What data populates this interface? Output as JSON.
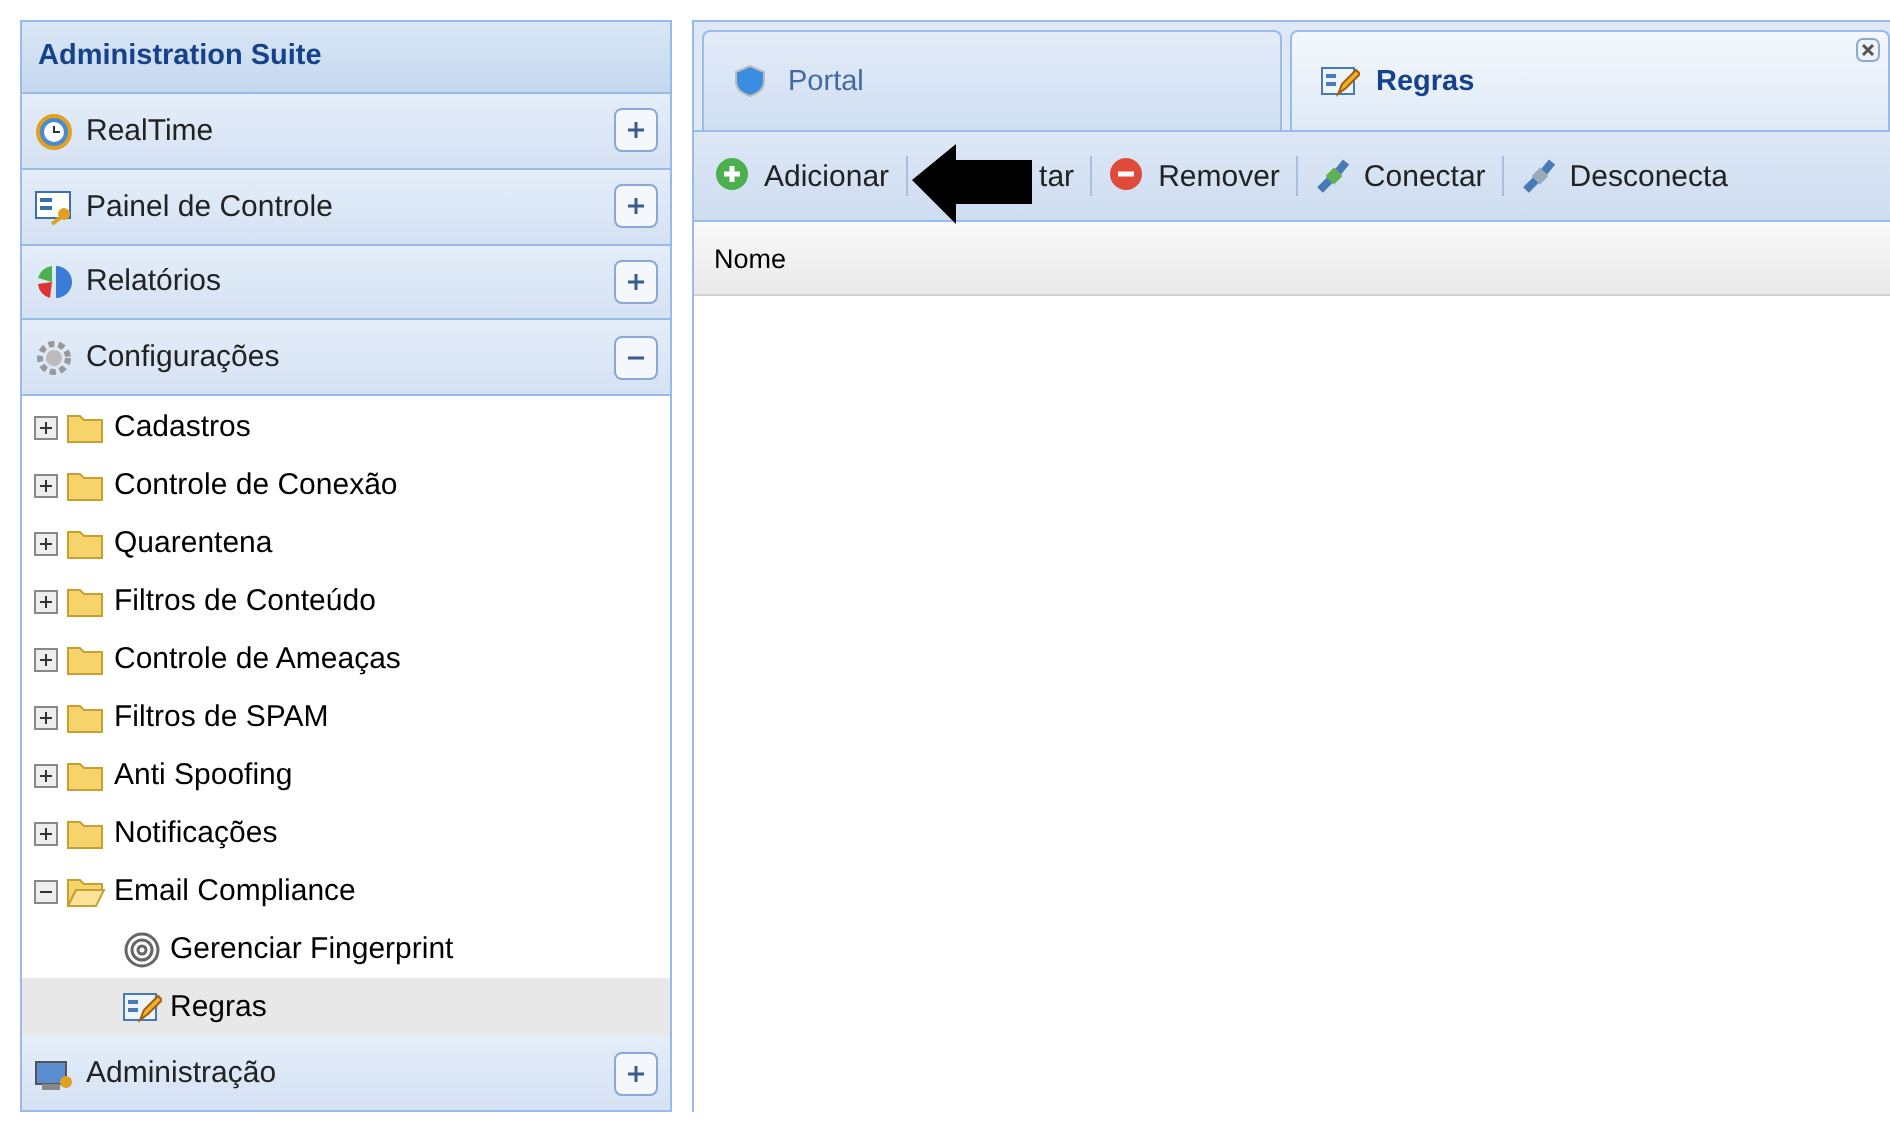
{
  "sidebar": {
    "title": "Administration Suite",
    "sections": [
      {
        "label": "RealTime",
        "expanded": false
      },
      {
        "label": "Painel de Controle",
        "expanded": false
      },
      {
        "label": "Relatórios",
        "expanded": false
      },
      {
        "label": "Configurações",
        "expanded": true,
        "tree": [
          {
            "label": "Cadastros",
            "kind": "folder",
            "expanded": false,
            "selected": false
          },
          {
            "label": "Controle de Conexão",
            "kind": "folder",
            "expanded": false,
            "selected": false
          },
          {
            "label": "Quarentena",
            "kind": "folder",
            "expanded": false,
            "selected": false
          },
          {
            "label": "Filtros de Conteúdo",
            "kind": "folder",
            "expanded": false,
            "selected": false
          },
          {
            "label": "Controle de Ameaças",
            "kind": "folder",
            "expanded": false,
            "selected": false
          },
          {
            "label": "Filtros de SPAM",
            "kind": "folder",
            "expanded": false,
            "selected": false
          },
          {
            "label": "Anti Spoofing",
            "kind": "folder",
            "expanded": false,
            "selected": false
          },
          {
            "label": "Notificações",
            "kind": "folder",
            "expanded": false,
            "selected": false
          },
          {
            "label": "Email Compliance",
            "kind": "folder",
            "expanded": true,
            "selected": false,
            "children": [
              {
                "label": "Gerenciar Fingerprint",
                "kind": "fingerprint",
                "selected": false
              },
              {
                "label": "Regras",
                "kind": "rules",
                "selected": true
              }
            ]
          }
        ]
      },
      {
        "label": "Administração",
        "expanded": false
      }
    ]
  },
  "tabs": [
    {
      "label": "Portal",
      "selected": false,
      "closable": false
    },
    {
      "label": "Regras",
      "selected": true,
      "closable": true
    }
  ],
  "toolbar": [
    "Adicionar",
    "tar",
    "Remover",
    "Conectar",
    "Desconecta"
  ],
  "table": {
    "columns": [
      "Nome"
    ]
  },
  "annotation": {
    "kind": "arrow"
  }
}
